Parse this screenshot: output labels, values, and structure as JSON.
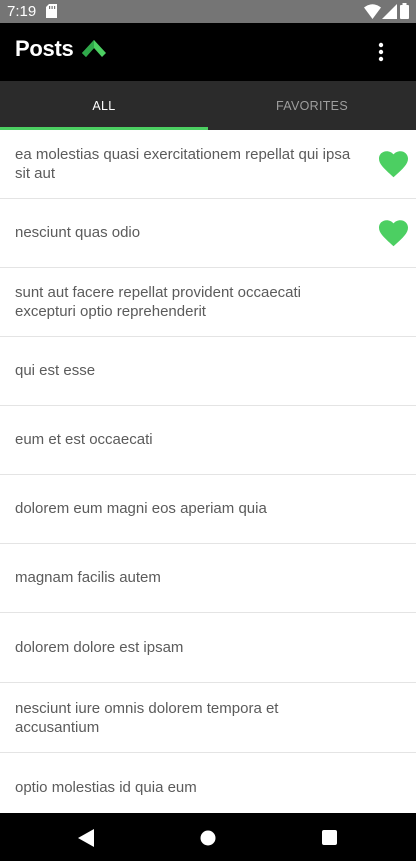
{
  "status_bar": {
    "time": "7:19",
    "icons": [
      "sd-card-icon",
      "wifi-icon",
      "signal-icon",
      "battery-icon"
    ]
  },
  "app_bar": {
    "title": "Posts",
    "logo_icon": "chevron-up-logo-icon",
    "menu_icon": "more-vert-icon"
  },
  "tabs": [
    {
      "label": "ALL",
      "selected": true
    },
    {
      "label": "FAVORITES",
      "selected": false
    }
  ],
  "posts": [
    {
      "title": "ea molestias quasi exercitationem repellat qui ipsa sit aut",
      "favorite": true
    },
    {
      "title": "nesciunt quas odio",
      "favorite": true
    },
    {
      "title": "sunt aut facere repellat provident occaecati excepturi optio reprehenderit",
      "favorite": false
    },
    {
      "title": "qui est esse",
      "favorite": false
    },
    {
      "title": "eum et est occaecati",
      "favorite": false
    },
    {
      "title": "dolorem eum magni eos aperiam quia",
      "favorite": false
    },
    {
      "title": "magnam facilis autem",
      "favorite": false
    },
    {
      "title": "dolorem dolore est ipsam",
      "favorite": false
    },
    {
      "title": "nesciunt iure omnis dolorem tempora et accusantium",
      "favorite": false
    },
    {
      "title": "optio molestias id quia eum",
      "favorite": false
    }
  ],
  "colors": {
    "accent": "#4ccf62",
    "app_bar": "#000000",
    "tab_bar": "#2b2b2b",
    "status_bar": "#757575",
    "text": "#5b5b5b"
  },
  "nav_bar": {
    "icons": [
      "back-icon",
      "home-icon",
      "recents-icon"
    ]
  }
}
